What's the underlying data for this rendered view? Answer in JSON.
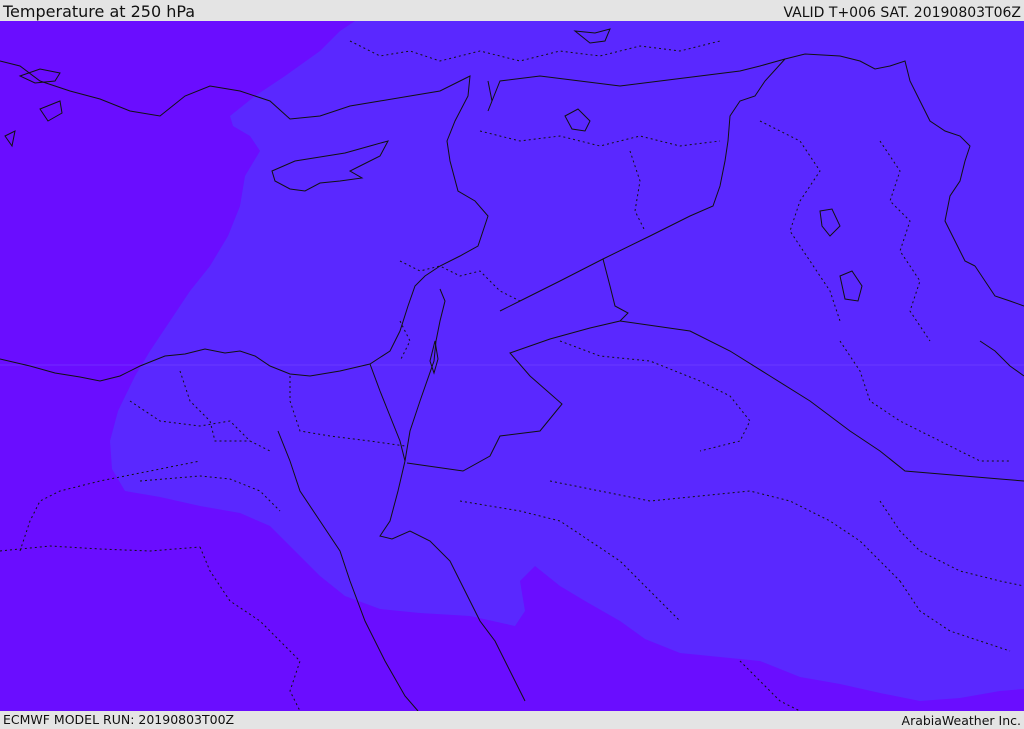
{
  "header": {
    "title": "Temperature at 250 hPa",
    "valid_time": "VALID T+006 SAT. 20190803T06Z"
  },
  "footer": {
    "model_run": "ECMWF MODEL RUN: 20190803T00Z",
    "credit": "ArabiaWeather Inc."
  },
  "colors": {
    "fill_cold": "#6a0dff",
    "fill_warm": "#5a28ff",
    "border_line": "#111111",
    "bar_background": "#e4e4e4"
  }
}
